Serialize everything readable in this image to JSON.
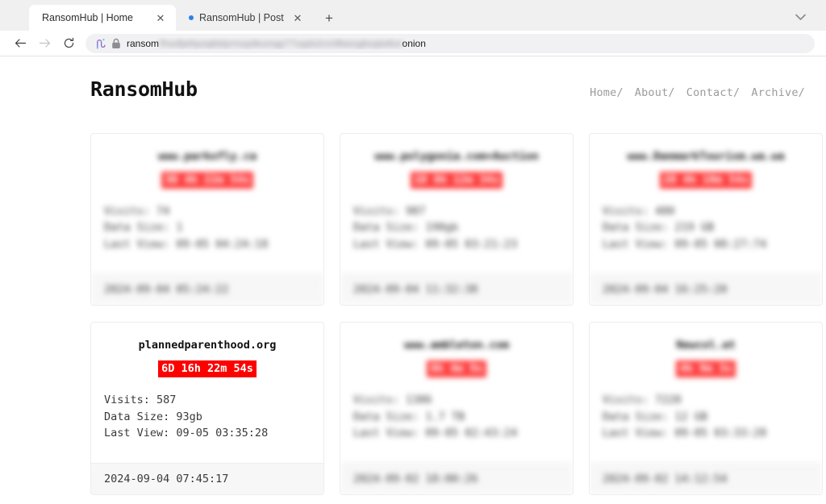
{
  "browser": {
    "tabs": [
      {
        "title": "RansomHub | Home",
        "active": true,
        "has_dot": false,
        "close_icon": "✕"
      },
      {
        "title": "RansomHub | Post",
        "active": false,
        "has_dot": true,
        "close_icon": "✕"
      }
    ],
    "new_tab_label": "+",
    "tab_list_icon": "chevron-down-icon",
    "toolbar": {
      "back_label": "←",
      "forward_label": "→",
      "reload_label": "⟳",
      "tor_icon": "tor-circuit-icon",
      "lock_icon": "padlock-icon",
      "url_prefix": "ransom",
      "url_redacted": "fhsefjwhpoqbtdyrnvqxlkumqp77uqds2cm9bwsgbsqtw6ut",
      "url_suffix": "onion"
    }
  },
  "site": {
    "brand": "RansomHub",
    "nav": [
      {
        "label": "Home/"
      },
      {
        "label": "About/"
      },
      {
        "label": "Contact/"
      },
      {
        "label": "Archive/"
      }
    ]
  },
  "cards": [
    {
      "redacted": true,
      "title": "www.parkofly.ca",
      "countdown": "3D 4h 22m 54s",
      "visits_label": "Visits: 74",
      "size_label": "Data Size: 1",
      "lastview_label": "Last View: 09-05 04:24:18",
      "footer": "2024-09-04 05:24:22"
    },
    {
      "redacted": true,
      "title": "www.polygonia.com+Auction",
      "countdown": "1D 8h 12m 34s",
      "visits_label": "Visits: 987",
      "size_label": "Data Size: 190gb",
      "lastview_label": "Last View: 09-05 03:21:23",
      "footer": "2024-09-04 11:32:38"
    },
    {
      "redacted": true,
      "title": "www.DanmarkTourism.wa.wa",
      "countdown": "2D 4h 10m 54s",
      "visits_label": "Visits: 480",
      "size_label": "Data Size: 219 GB",
      "lastview_label": "Last View: 09-05 08:27:74",
      "footer": "2024-09-04 16:25:20"
    },
    {
      "redacted": false,
      "title": "plannedparenthood.org",
      "countdown": "6D 16h 22m 54s",
      "visits_label": "Visits: 587",
      "size_label": "Data Size: 93gb",
      "lastview_label": "Last View: 09-05 03:35:28",
      "footer": "2024-09-04 07:45:17"
    },
    {
      "redacted": true,
      "title": "www.ambleton.com",
      "countdown": "8h 4m 9s",
      "visits_label": "Visits: 1386",
      "size_label": "Data Size: 1.7 TB",
      "lastview_label": "Last View: 09-05 02:43:24",
      "footer": "2024-09-02 18:00:26"
    },
    {
      "redacted": true,
      "title": "Newcol.at",
      "countdown": "4h 9m 3s",
      "visits_label": "Visits: 7228",
      "size_label": "Data Size: 12 GB",
      "lastview_label": "Last View: 09-05 03:33:28",
      "footer": "2024-09-02 14:12:54"
    }
  ],
  "colors": {
    "countdown_bg": "#fd0000",
    "countdown_text": "#ffffff",
    "card_border": "#ededed",
    "footer_bg": "#f7f7f7",
    "nav_link": "#9b9b9b",
    "tab_dot": "#2f7fe8"
  }
}
